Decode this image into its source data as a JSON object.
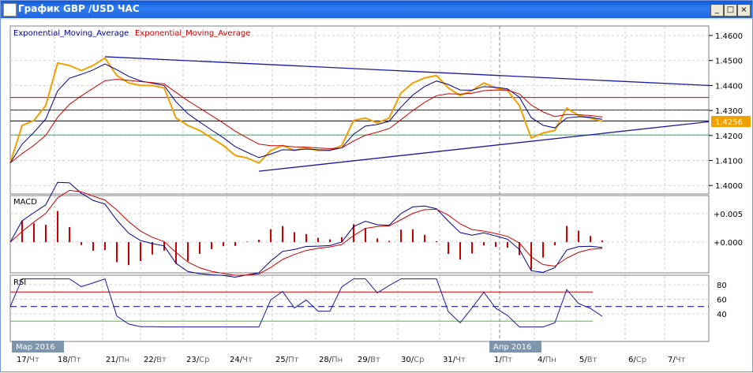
{
  "window": {
    "title": "График GBP /USD  ЧАС",
    "min": "_",
    "max": "□",
    "close": "×"
  },
  "legend": {
    "ema1": "Exponential_Moving_Average",
    "ema2": "Exponential_Moving_Average"
  },
  "colors": {
    "price": "#f0a000",
    "ema_fast": "#00008b",
    "ema_slow": "#cc0000",
    "trend": "#1a1aa0",
    "level_red": "#cc0000",
    "level_green": "#33aa66"
  },
  "chart_data": {
    "type": "line",
    "title": "График GBP /USD  ЧАС",
    "price_axis": {
      "ticks": [
        "1.4600",
        "1.4500",
        "1.4400",
        "1.4300",
        "1.4200",
        "1.4100",
        "1.4000"
      ],
      "range": [
        1.3975,
        1.4645
      ]
    },
    "last_price": "1.4256",
    "price": [
      1.409,
      1.424,
      1.426,
      1.432,
      1.449,
      1.448,
      1.446,
      1.448,
      1.451,
      1.444,
      1.441,
      1.44,
      1.44,
      1.439,
      1.427,
      1.424,
      1.422,
      1.419,
      1.416,
      1.412,
      1.411,
      1.409,
      1.414,
      1.416,
      1.414,
      1.415,
      1.414,
      1.414,
      1.416,
      1.426,
      1.427,
      1.425,
      1.427,
      1.437,
      1.441,
      1.443,
      1.444,
      1.439,
      1.436,
      1.438,
      1.441,
      1.439,
      1.438,
      1.432,
      1.419,
      1.421,
      1.422,
      1.431,
      1.428,
      1.427,
      1.4256
    ],
    "levels": [
      {
        "price": 1.4352,
        "color": "red"
      },
      {
        "price": 1.4302,
        "color": "red"
      },
      {
        "price": 1.4258,
        "color": "black"
      },
      {
        "price": 1.4202,
        "color": "green"
      }
    ],
    "trendlines": [
      {
        "from": [
          8,
          1.4515
        ],
        "to": [
          59,
          1.44
        ]
      },
      {
        "from": [
          21,
          1.4057
        ],
        "to": [
          59,
          1.4255
        ]
      }
    ],
    "macd": {
      "label": "MACD",
      "ticks": [
        "+0.005",
        "+0.000"
      ]
    },
    "rsi": {
      "label": "RSI",
      "ticks": [
        "80",
        "60",
        "40"
      ],
      "upper": 70,
      "lower": 30,
      "mid": 50
    },
    "x_labels": [
      {
        "d": "17",
        "w": "Чт"
      },
      {
        "d": "18",
        "w": "Пт"
      },
      {
        "d": "21",
        "w": "Пн"
      },
      {
        "d": "22",
        "w": "Вт"
      },
      {
        "d": "23",
        "w": "Ср"
      },
      {
        "d": "24",
        "w": "Чт"
      },
      {
        "d": "25",
        "w": "Пт"
      },
      {
        "d": "28",
        "w": "Пн"
      },
      {
        "d": "29",
        "w": "Вт"
      },
      {
        "d": "30",
        "w": "Ср"
      },
      {
        "d": "31",
        "w": "Чт"
      },
      {
        "d": "1",
        "w": "Пт"
      },
      {
        "d": "4",
        "w": "Пн"
      },
      {
        "d": "5",
        "w": "Вт"
      },
      {
        "d": "6",
        "w": "Ср"
      },
      {
        "d": "7",
        "w": "Чт"
      }
    ],
    "month_labels": [
      "Мар 2016",
      "Апр 2016"
    ]
  }
}
